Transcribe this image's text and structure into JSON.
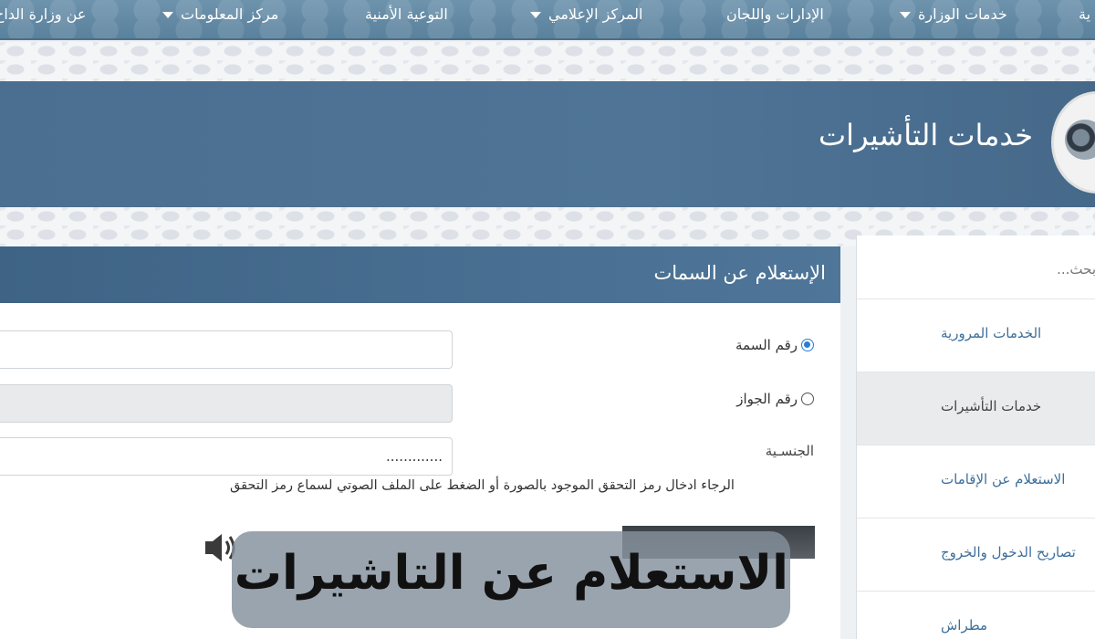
{
  "nav": {
    "items": [
      {
        "label": "عن وزارة الداخ",
        "dropdown": false
      },
      {
        "label": "مركز المعلومات",
        "dropdown": true
      },
      {
        "label": "التوعية الأمنية",
        "dropdown": false
      },
      {
        "label": "المركز الإعلامي",
        "dropdown": true
      },
      {
        "label": "الإدارات واللجان",
        "dropdown": false
      },
      {
        "label": "خدمات الوزارة",
        "dropdown": true
      },
      {
        "label": "ية",
        "dropdown": false
      }
    ]
  },
  "banner": {
    "title": "خدمات التأشيرات"
  },
  "sidebar": {
    "search_placeholder": "بحث...",
    "items": [
      {
        "label": "الخدمات المرورية",
        "active": false
      },
      {
        "label": "خدمات التأشيرات",
        "active": true
      },
      {
        "label": "الاستعلام عن الإقامات",
        "active": false
      },
      {
        "label": "تصاريح الدخول والخروج",
        "active": false
      },
      {
        "label": "مطراش",
        "active": false
      }
    ]
  },
  "panel": {
    "title": "الإستعلام عن السمات",
    "radio_visa_label": "رقم السمة",
    "radio_passport_label": "رقم الجواز",
    "nationality_label": "الجنسـية",
    "nationality_value": ".............",
    "instruction": "الرجاء ادخال رمز التحقق الموجود بالصورة أو الضغط على الملف الصوتي لسماع رمز التحقق"
  },
  "overlay": {
    "text": "الاستعلام عن التاشيرات"
  },
  "colors": {
    "nav_bg": "#5f86a2",
    "banner_bg": "#4b6f91",
    "panel_header_bg": "#46698d",
    "link_color": "#3d6f9b",
    "radio_selected": "#2a7fd4"
  }
}
